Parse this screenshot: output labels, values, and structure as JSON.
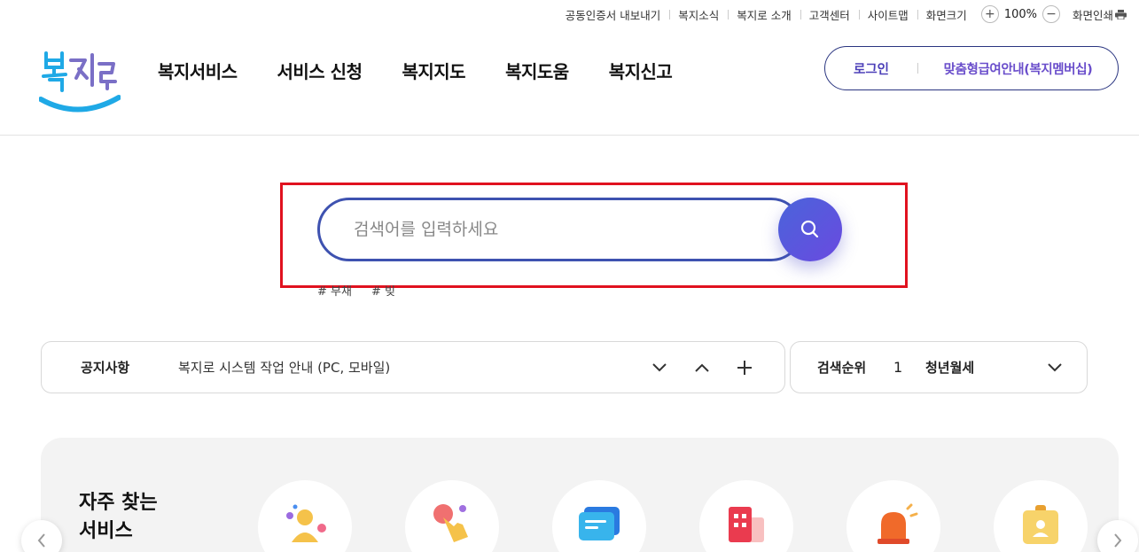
{
  "util": {
    "links": [
      "공동인증서 내보내기",
      "복지소식",
      "복지로 소개",
      "고객센터",
      "사이트맵"
    ],
    "zoom_label": "화면크기",
    "zoom_value": "100%",
    "print_label": "화면인쇄"
  },
  "header": {
    "logo_text": "복지로",
    "nav": [
      "복지서비스",
      "서비스 신청",
      "복지지도",
      "복지도움",
      "복지신고"
    ],
    "login": "로그인",
    "custom_guide": "맞춤형급여안내(복지멤버십)"
  },
  "search": {
    "placeholder": "검색어를 입력하세요",
    "hashtags": [
      "# 부채",
      "# 빚"
    ],
    "highlight_color": "#e0121f"
  },
  "notice": {
    "label": "공지사항",
    "text": "복지로 시스템 작업 안내 (PC, 모바일)"
  },
  "ranking": {
    "label": "검색순위",
    "rank": "1",
    "term": "청년월세"
  },
  "services": {
    "title_line1": "자주 찾는",
    "title_line2": "서비스",
    "icons": [
      "people-icon",
      "touch-icon",
      "message-icon",
      "building-icon",
      "alarm-icon",
      "id-card-icon"
    ]
  },
  "colors": {
    "accent": "#4a56c8",
    "brand_blue": "#1fa9e6"
  }
}
